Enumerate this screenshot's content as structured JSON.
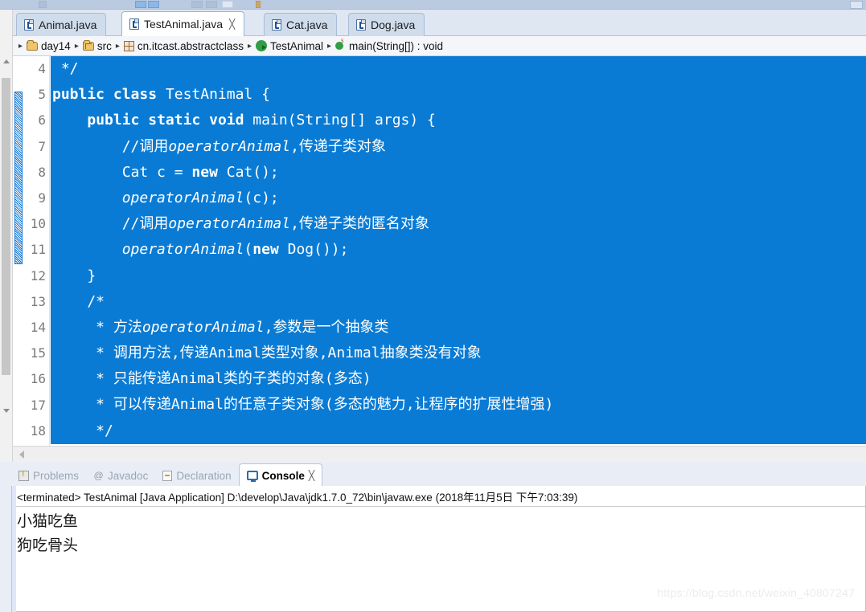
{
  "toolbar": {
    "name": "partial-toolbar-strip"
  },
  "editor_tabs": [
    {
      "label": "Animal.java",
      "icon": "java-file-icon",
      "active": false,
      "closable": false
    },
    {
      "label": "TestAnimal.java",
      "icon": "java-file-icon",
      "active": true,
      "closable": true,
      "close_glyph": "╳"
    },
    {
      "label": "Cat.java",
      "icon": "java-file-icon",
      "active": false,
      "closable": false
    },
    {
      "label": "Dog.java",
      "icon": "java-file-icon",
      "active": false,
      "closable": false
    }
  ],
  "breadcrumb": {
    "separator": "▸",
    "items": [
      {
        "label": "day14",
        "icon": "folder-icon"
      },
      {
        "label": "src",
        "icon": "source-folder-icon"
      },
      {
        "label": "cn.itcast.abstractclass",
        "icon": "package-icon"
      },
      {
        "label": "TestAnimal",
        "icon": "class-icon"
      },
      {
        "label": "main(String[]) : void",
        "icon": "static-method-icon"
      }
    ]
  },
  "editor": {
    "selection_color": "#0a7bd4",
    "selection_text_color": "#ffffff",
    "gutter_text_color": "#7b7b7b",
    "first_line": 4,
    "lines": [
      {
        "n": 4,
        "text": " */"
      },
      {
        "n": 5,
        "text": "public class TestAnimal {"
      },
      {
        "n": 6,
        "text": "    public static void main(String[] args) {"
      },
      {
        "n": 7,
        "text": "        //调用operatorAnimal,传递子类对象"
      },
      {
        "n": 8,
        "text": "        Cat c = new Cat();"
      },
      {
        "n": 9,
        "text": "        operatorAnimal(c);"
      },
      {
        "n": 10,
        "text": "        //调用operatorAnimal,传递子类的匿名对象"
      },
      {
        "n": 11,
        "text": "        operatorAnimal(new Dog());"
      },
      {
        "n": 12,
        "text": "    }"
      },
      {
        "n": 13,
        "text": "    /*"
      },
      {
        "n": 14,
        "text": "     * 方法operatorAnimal,参数是一个抽象类"
      },
      {
        "n": 15,
        "text": "     * 调用方法,传递Animal类型对象,Animal抽象类没有对象"
      },
      {
        "n": 16,
        "text": "     * 只能传递Animal类的子类的对象(多态)"
      },
      {
        "n": 17,
        "text": "     * 可以传递Animal的任意子类对象(多态的魅力,让程序的扩展性增强)"
      },
      {
        "n": 18,
        "text": "     */"
      }
    ]
  },
  "bottom_tabs": [
    {
      "label": "Problems",
      "icon": "problems-icon",
      "active": false
    },
    {
      "label": "Javadoc",
      "icon": "javadoc-icon",
      "active": false,
      "glyph": "@"
    },
    {
      "label": "Declaration",
      "icon": "declaration-icon",
      "active": false
    },
    {
      "label": "Console",
      "icon": "console-icon",
      "active": true,
      "close_glyph": "╳"
    }
  ],
  "console": {
    "header": "<terminated> TestAnimal [Java Application] D:\\develop\\Java\\jdk1.7.0_72\\bin\\javaw.exe (2018年11月5日 下午7:03:39)",
    "output_lines": [
      "小猫吃鱼",
      "狗吃骨头"
    ]
  },
  "watermark": "https://blog.csdn.net/weixin_40807247"
}
